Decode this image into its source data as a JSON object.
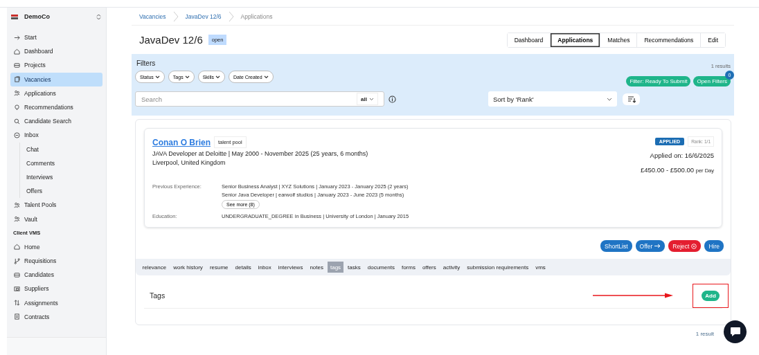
{
  "sidebar": {
    "org": "DemoCo",
    "items": [
      {
        "kind": "item",
        "label": "Start",
        "selected": false
      },
      {
        "kind": "item",
        "label": "Dashboard",
        "selected": false
      },
      {
        "kind": "item",
        "label": "Projects",
        "selected": false
      },
      {
        "kind": "item",
        "label": "Vacancies",
        "selected": true
      },
      {
        "kind": "item",
        "label": "Applications",
        "selected": false
      },
      {
        "kind": "item",
        "label": "Recommendations",
        "selected": false
      },
      {
        "kind": "item",
        "label": "Candidate Search",
        "selected": false
      },
      {
        "kind": "item",
        "label": "Inbox",
        "selected": false
      },
      {
        "kind": "sub",
        "label": "Chat",
        "selected": false
      },
      {
        "kind": "sub",
        "label": "Comments",
        "selected": false
      },
      {
        "kind": "sub",
        "label": "Interviews",
        "selected": false
      },
      {
        "kind": "sub",
        "label": "Offers",
        "selected": false
      },
      {
        "kind": "item",
        "label": "Talent Pools",
        "selected": false
      },
      {
        "kind": "item",
        "label": "Vault",
        "selected": false
      },
      {
        "kind": "section",
        "label": "Client VMS"
      },
      {
        "kind": "item",
        "label": "Home",
        "selected": false
      },
      {
        "kind": "item",
        "label": "Requisitions",
        "selected": false
      },
      {
        "kind": "item",
        "label": "Candidates",
        "selected": false
      },
      {
        "kind": "item",
        "label": "Suppliers",
        "selected": false
      },
      {
        "kind": "item",
        "label": "Assignments",
        "selected": false
      },
      {
        "kind": "item",
        "label": "Contracts",
        "selected": false
      }
    ]
  },
  "breadcrumb": [
    "Vacancies",
    "JavaDev 12/6",
    "Applications"
  ],
  "title": "JavaDev 12/6",
  "status_badge": "open",
  "nav_tabs": [
    {
      "label": "Dashboard",
      "selected": false
    },
    {
      "label": "Applications",
      "selected": true
    },
    {
      "label": "Matches",
      "selected": false
    },
    {
      "label": "Recommendations",
      "selected": false
    },
    {
      "label": "Edit",
      "selected": false
    }
  ],
  "filters": {
    "title": "Filters",
    "results": "1 results",
    "chips": [
      "Status",
      "Tags",
      "Skills",
      "Date Created"
    ],
    "ready_button": "Filter: Ready To Submit",
    "open_button": "Open Filters",
    "open_badge": "0",
    "search": {
      "placeholder": "Search",
      "scope": "all"
    },
    "sort": "Sort by 'Rank'"
  },
  "application": {
    "name": "Conan O Brien",
    "tag": "talent pool",
    "headline": "JAVA Developer at Deloitte | May 2000 - November 2025 (25 years, 6 months)",
    "location": "Liverpool, United Kingdom",
    "status": "APPLIED",
    "rank": "Rank: 1/1",
    "applied_on": "Applied on: 16/6/2025",
    "rate": "£450.00 - £500.00",
    "rate_unit": "per Day",
    "experience_label": "Previous Experience:",
    "experience": [
      "Senior Business Analyst | XYZ Solutions | January 2023 - January 2025 (2 years)",
      "Senior Java Developer | earwolf studios | January 2023 - June 2023 (5 months)"
    ],
    "see_more": "See more (8)",
    "education_label": "Education:",
    "education": "UNDERGRADUATE_DEGREE in Business | University of London | January 2015"
  },
  "actions": [
    {
      "label": "ShortList",
      "kind": "plain"
    },
    {
      "label": "Offer",
      "kind": "arrow"
    },
    {
      "label": "Reject",
      "kind": "reject"
    },
    {
      "label": "Hire",
      "kind": "plain"
    }
  ],
  "detail_tabs": [
    {
      "label": "relevance",
      "selected": false
    },
    {
      "label": "work history",
      "selected": false
    },
    {
      "label": "resume",
      "selected": false
    },
    {
      "label": "details",
      "selected": false
    },
    {
      "label": "inbox",
      "selected": false
    },
    {
      "label": "interviews",
      "selected": false
    },
    {
      "label": "notes",
      "selected": false
    },
    {
      "label": "tags",
      "selected": true
    },
    {
      "label": "tasks",
      "selected": false
    },
    {
      "label": "documents",
      "selected": false
    },
    {
      "label": "forms",
      "selected": false
    },
    {
      "label": "offers",
      "selected": false
    },
    {
      "label": "activity",
      "selected": false
    },
    {
      "label": "submission requirements",
      "selected": false
    },
    {
      "label": "vms",
      "selected": false
    }
  ],
  "tags_section": {
    "title": "Tags",
    "add_button": "Add"
  },
  "footer_results": "1 result"
}
